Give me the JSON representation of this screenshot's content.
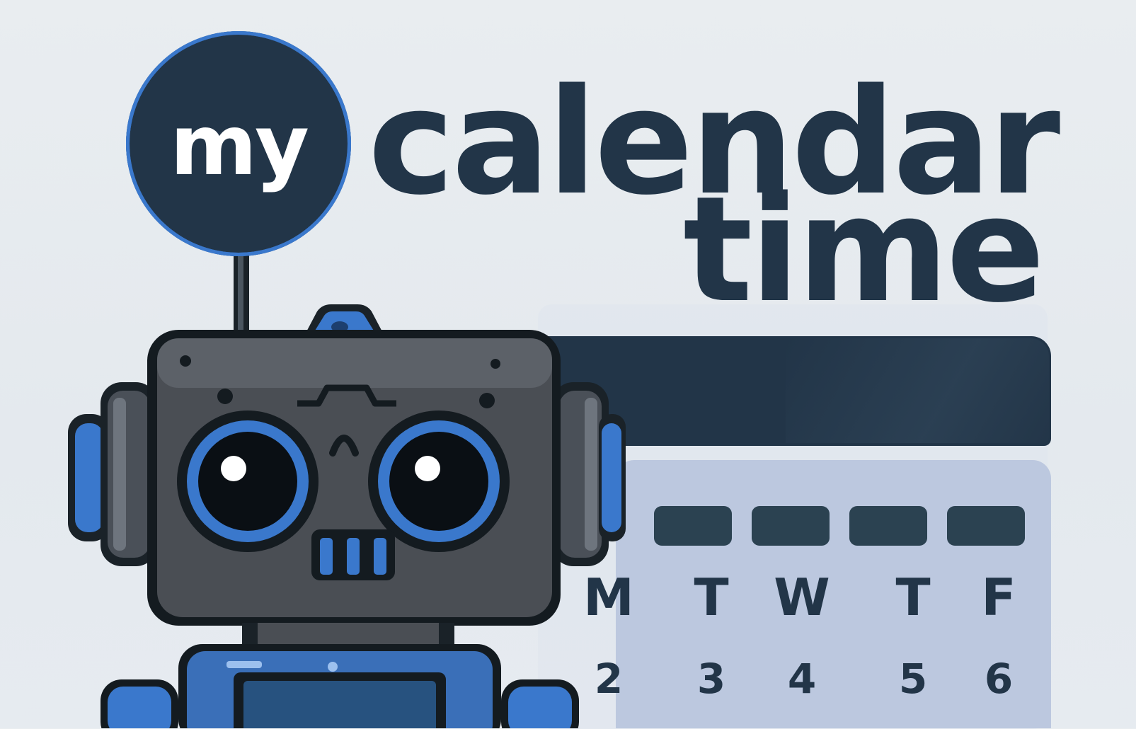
{
  "logo": {
    "badge_text": "my",
    "word1": "calendar",
    "word2": "time"
  },
  "calendar": {
    "days": [
      {
        "letter": "M",
        "number": "2"
      },
      {
        "letter": "T",
        "number": "3"
      },
      {
        "letter": "W",
        "number": "4"
      },
      {
        "letter": "T",
        "number": "5"
      },
      {
        "letter": "F",
        "number": "6"
      }
    ]
  },
  "colors": {
    "navy": "#223548",
    "accent_blue": "#3a78cc",
    "calendar_body": "#bcc8df",
    "background": "#e7ecf0"
  },
  "icons": [
    "robot-mascot-illustration",
    "calendar-illustration"
  ]
}
